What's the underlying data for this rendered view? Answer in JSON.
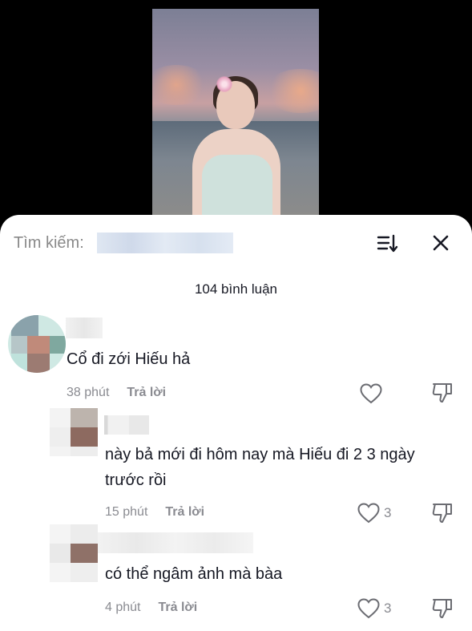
{
  "search": {
    "label": "Tìm kiếm:"
  },
  "comments_header": {
    "count_label": "104 bình luận"
  },
  "comments": [
    {
      "text": "Cổ đi zới Hiếu hả",
      "time": "38 phút",
      "reply_label": "Trả lời",
      "likes": ""
    },
    {
      "text": "này bả mới đi hôm nay mà Hiếu đi 2 3 ngày trước rồi",
      "time": "15 phút",
      "reply_label": "Trả lời",
      "likes": "3"
    },
    {
      "text": "có thể ngâm ảnh mà bàa",
      "time": "4 phút",
      "reply_label": "Trả lời",
      "likes": "3"
    }
  ],
  "icons": [
    "sort-icon",
    "close-icon",
    "heart-icon",
    "dislike-icon"
  ],
  "colors": {
    "text": "#161823",
    "muted": "#8a8b91",
    "sheet_bg": "#ffffff",
    "backdrop": "#000000"
  }
}
